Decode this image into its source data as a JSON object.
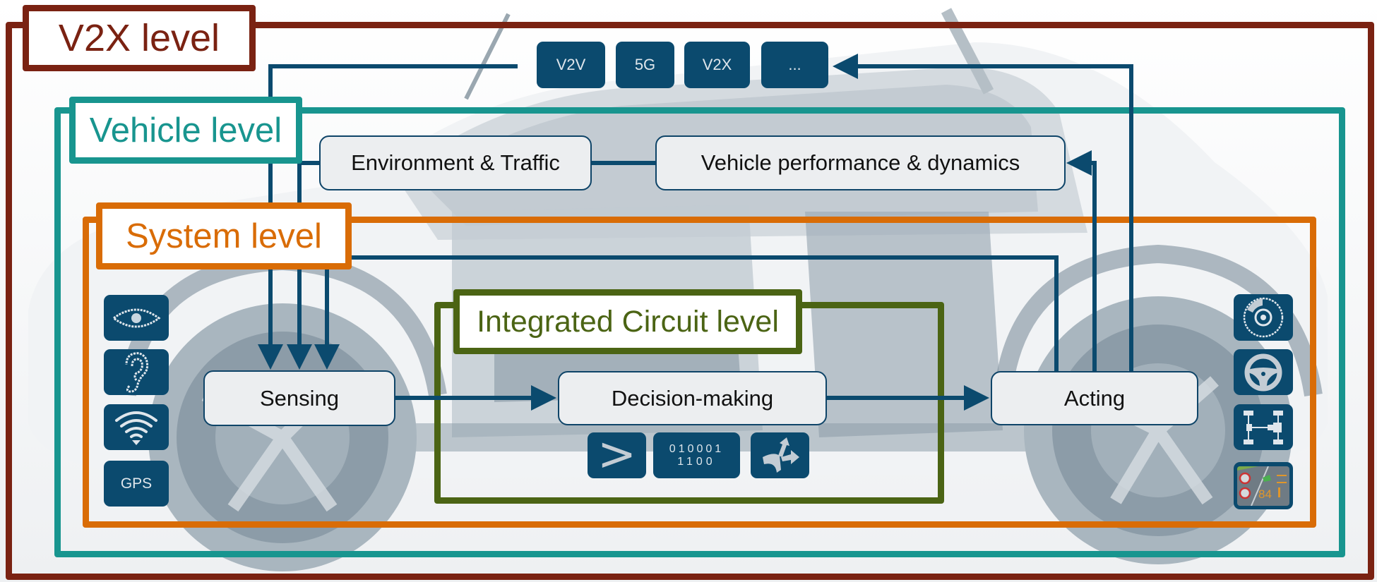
{
  "colors": {
    "v2x": "#7a2212",
    "vehicle": "#18958f",
    "system": "#d96c06",
    "ic": "#4b6414",
    "navy": "#0b4a6e",
    "node_fill": "#eceef0"
  },
  "levels": {
    "v2x": "V2X level",
    "vehicle": "Vehicle level",
    "system": "System level",
    "ic": "Integrated Circuit level"
  },
  "communication": [
    {
      "label": "V2V"
    },
    {
      "label": "5G"
    },
    {
      "label": "V2X"
    },
    {
      "label": "..."
    }
  ],
  "nodes": {
    "environment": "Environment & Traffic",
    "vehicle_dynamics": "Vehicle performance & dynamics",
    "sensing": "Sensing",
    "decision": "Decision-making",
    "acting": "Acting"
  },
  "sensor_icons": [
    {
      "icon": "eye-icon"
    },
    {
      "icon": "ear-icon"
    },
    {
      "icon": "wireless-signal-icon"
    },
    {
      "icon": "gps-icon",
      "label": "GPS"
    }
  ],
  "decision_icons": [
    {
      "icon": "comparison-greater-than-icon",
      "label": ">"
    },
    {
      "icon": "binary-data-icon",
      "line1": "010001",
      "line2": "1100"
    },
    {
      "icon": "route-choice-arrows-icon"
    }
  ],
  "actuator_icons": [
    {
      "icon": "brake-disc-icon"
    },
    {
      "icon": "steering-wheel-icon"
    },
    {
      "icon": "drivetrain-icon"
    },
    {
      "icon": "head-up-display-icon",
      "speed": "84"
    }
  ]
}
